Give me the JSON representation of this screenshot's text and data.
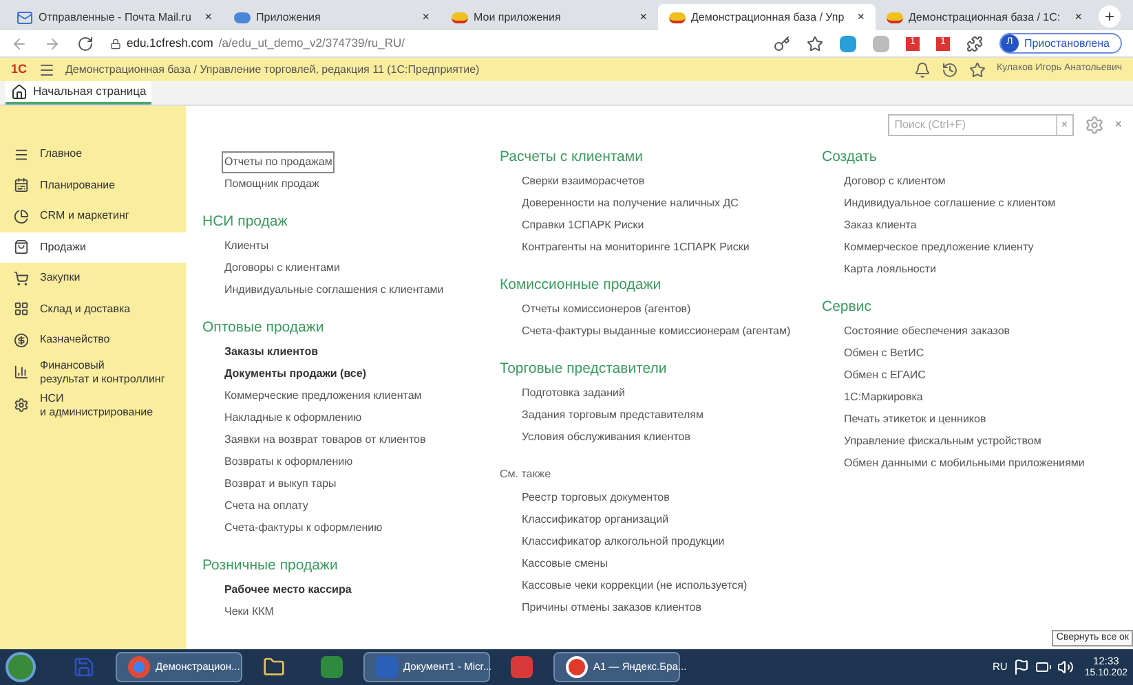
{
  "browser": {
    "tabs": [
      {
        "label": "Отправленные - Почта Mail.ru",
        "close": "×",
        "selected": false
      },
      {
        "label": "Приложения",
        "close": "×",
        "selected": false
      },
      {
        "label": "Мои приложения",
        "close": "×",
        "selected": false
      },
      {
        "label": "Демонстрационная база / Упр",
        "close": "×",
        "selected": true
      },
      {
        "label": "Демонстрационная база / 1С:",
        "close": "×",
        "selected": false
      }
    ],
    "new_tab": "+",
    "url_host": "edu.1cfresh.com",
    "url_path": "/a/edu_ut_demo_v2/374739/ru_RU/",
    "extension_badges": [
      "1",
      "1"
    ],
    "profile": {
      "initial": "Л",
      "label": "Приостановлена"
    }
  },
  "app_header": {
    "logo": "1С",
    "title": "Демонстрационная база / Управление торговлей, редакция 11  (1С:Предприятие)",
    "user": "Кулаков Игорь Анатольевич"
  },
  "home_tab": {
    "label": "Начальная страница",
    "selected": true
  },
  "sidebar": {
    "items": [
      {
        "lines": [
          "Главное"
        ],
        "selected": false
      },
      {
        "lines": [
          "Планирование"
        ],
        "selected": false
      },
      {
        "lines": [
          "CRM и маркетинг"
        ],
        "selected": false
      },
      {
        "lines": [
          "Продажи"
        ],
        "selected": true
      },
      {
        "lines": [
          "Закупки"
        ],
        "selected": false
      },
      {
        "lines": [
          "Склад и доставка"
        ],
        "selected": false
      },
      {
        "lines": [
          "Казначейство"
        ],
        "selected": false
      },
      {
        "lines": [
          "Финансовый",
          "результат и контроллинг"
        ],
        "selected": false
      },
      {
        "lines": [
          "НСИ",
          "и администрирование"
        ],
        "selected": false
      }
    ]
  },
  "search": {
    "placeholder": "Поиск (Ctrl+F)",
    "clear": "×",
    "close": "×"
  },
  "columns": [
    [
      {
        "items": [
          {
            "label": "Отчеты по продажам",
            "bold": false,
            "focused": true
          },
          {
            "label": "Помощник продаж",
            "bold": false,
            "focused": false
          }
        ]
      },
      {
        "heading": "НСИ продаж",
        "kind": "section",
        "items": [
          {
            "label": "Клиенты",
            "bold": false,
            "focused": false
          },
          {
            "label": "Договоры с клиентами",
            "bold": false,
            "focused": false
          },
          {
            "label": "Индивидуальные соглашения с клиентами",
            "bold": false,
            "focused": false
          }
        ]
      },
      {
        "heading": "Оптовые продажи",
        "kind": "section",
        "items": [
          {
            "label": "Заказы клиентов",
            "bold": true,
            "focused": false
          },
          {
            "label": "Документы продажи (все)",
            "bold": true,
            "focused": false
          },
          {
            "label": "Коммерческие предложения клиентам",
            "bold": false,
            "focused": false
          },
          {
            "label": "Накладные к оформлению",
            "bold": false,
            "focused": false
          },
          {
            "label": "Заявки на возврат товаров от клиентов",
            "bold": false,
            "focused": false
          },
          {
            "label": "Возвраты к оформлению",
            "bold": false,
            "focused": false
          },
          {
            "label": "Возврат и выкуп тары",
            "bold": false,
            "focused": false
          },
          {
            "label": "Счета на оплату",
            "bold": false,
            "focused": false
          },
          {
            "label": "Счета-фактуры к оформлению",
            "bold": false,
            "focused": false
          }
        ]
      },
      {
        "heading": "Розничные продажи",
        "kind": "section",
        "items": [
          {
            "label": "Рабочее место кассира",
            "bold": true,
            "focused": false
          },
          {
            "label": "Чеки ККМ",
            "bold": false,
            "focused": false
          }
        ]
      }
    ],
    [
      {
        "heading": "Расчеты с клиентами",
        "kind": "section",
        "items": [
          {
            "label": "Сверки взаиморасчетов",
            "bold": false,
            "focused": false
          },
          {
            "label": "Доверенности на получение наличных ДС",
            "bold": false,
            "focused": false
          },
          {
            "label": "Справки 1СПАРК Риски",
            "bold": false,
            "focused": false
          },
          {
            "label": "Контрагенты на мониторинге 1СПАРК Риски",
            "bold": false,
            "focused": false
          }
        ]
      },
      {
        "heading": "Комиссионные продажи",
        "kind": "section",
        "items": [
          {
            "label": "Отчеты комиссионеров (агентов)",
            "bold": false,
            "focused": false
          },
          {
            "label": "Счета-фактуры выданные комиссионерам (агентам)",
            "bold": false,
            "focused": false
          }
        ]
      },
      {
        "heading": "Торговые представители",
        "kind": "section",
        "items": [
          {
            "label": "Подготовка заданий",
            "bold": false,
            "focused": false
          },
          {
            "label": "Задания торговым представителям",
            "bold": false,
            "focused": false
          },
          {
            "label": "Условия обслуживания клиентов",
            "bold": false,
            "focused": false
          }
        ]
      },
      {
        "heading": "См. также",
        "kind": "see_also",
        "items": [
          {
            "label": "Реестр торговых документов",
            "bold": false,
            "focused": false
          },
          {
            "label": "Классификатор организаций",
            "bold": false,
            "focused": false
          },
          {
            "label": "Классификатор алкогольной продукции",
            "bold": false,
            "focused": false
          },
          {
            "label": "Кассовые смены",
            "bold": false,
            "focused": false
          },
          {
            "label": "Кассовые чеки коррекции (не используется)",
            "bold": false,
            "focused": false
          },
          {
            "label": "Причины отмены заказов клиентов",
            "bold": false,
            "focused": false
          }
        ]
      }
    ],
    [
      {
        "heading": "Создать",
        "kind": "section",
        "items": [
          {
            "label": "Договор с клиентом",
            "bold": false,
            "focused": false
          },
          {
            "label": "Индивидуальное соглашение с клиентом",
            "bold": false,
            "focused": false
          },
          {
            "label": "Заказ клиента",
            "bold": false,
            "focused": false
          },
          {
            "label": "Коммерческое предложение клиенту",
            "bold": false,
            "focused": false
          },
          {
            "label": "Карта лояльности",
            "bold": false,
            "focused": false
          }
        ]
      },
      {
        "heading": "Сервис",
        "kind": "section",
        "items": [
          {
            "label": "Состояние обеспечения заказов",
            "bold": false,
            "focused": false
          },
          {
            "label": "Обмен с ВетИС",
            "bold": false,
            "focused": false
          },
          {
            "label": "Обмен с ЕГАИС",
            "bold": false,
            "focused": false
          },
          {
            "label": "1С:Маркировка",
            "bold": false,
            "focused": false
          },
          {
            "label": "Печать этикеток и ценников",
            "bold": false,
            "focused": false
          },
          {
            "label": "Управление фискальным устройством",
            "bold": false,
            "focused": false
          },
          {
            "label": "Обмен данными с мобильными приложениями",
            "bold": false,
            "focused": false
          }
        ]
      }
    ]
  ],
  "tooltip": "Свернуть все ок",
  "taskbar": {
    "items": [
      {
        "selected": false
      },
      {
        "label": "Демонстрацион...",
        "selected": true
      },
      {
        "selected": false
      },
      {
        "selected": false
      },
      {
        "label": "Документ1 - Micr...",
        "selected": true
      },
      {
        "selected": false
      },
      {
        "label": "А1 — Яндекс.Бра...",
        "selected": true
      }
    ],
    "language": "RU",
    "time": "12:33",
    "date": "15.10.202"
  }
}
